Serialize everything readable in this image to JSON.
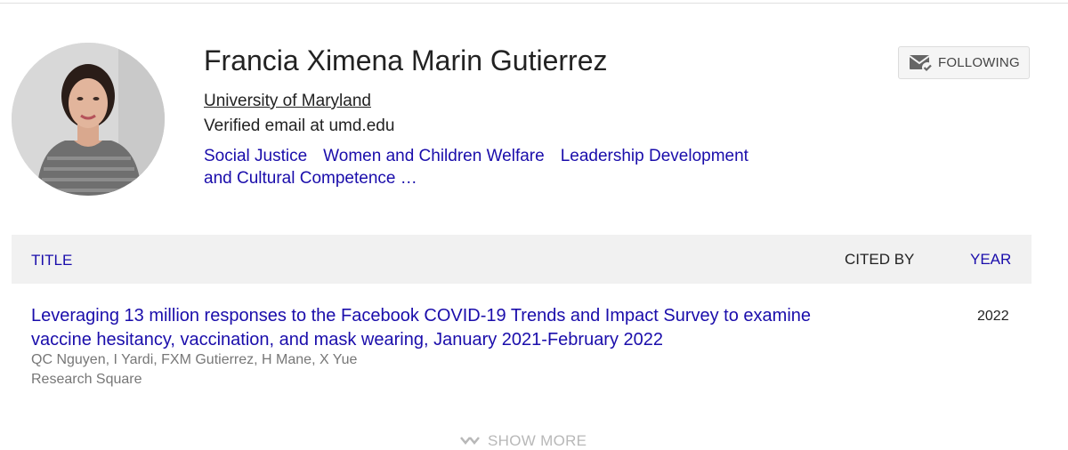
{
  "profile": {
    "name": "Francia Ximena Marin Gutierrez",
    "affiliation": "University of Maryland",
    "email_note": "Verified email at umd.edu",
    "interests": [
      "Social Justice",
      "Women and Children Welfare",
      "Leadership Development",
      "and Cultural Competence …"
    ]
  },
  "follow_button": {
    "label": "FOLLOWING",
    "icon": "mail-check-icon"
  },
  "table": {
    "headers": {
      "title": "TITLE",
      "cited_by": "CITED BY",
      "year": "YEAR"
    },
    "rows": [
      {
        "title": "Leveraging 13 million responses to the Facebook COVID-19 Trends and Impact Survey to examine vaccine hesitancy, vaccination, and mask wearing, January 2021-February 2022",
        "authors": "QC Nguyen, I Yardi, FXM Gutierrez, H Mane, X Yue",
        "venue": "Research Square",
        "cited_by": "",
        "year": "2022"
      }
    ]
  },
  "show_more": {
    "label": "SHOW MORE",
    "icon": "chevron-down-icon"
  },
  "colors": {
    "link": "#1a0dab",
    "header_bg": "#f1f1f1",
    "muted": "#777777"
  }
}
